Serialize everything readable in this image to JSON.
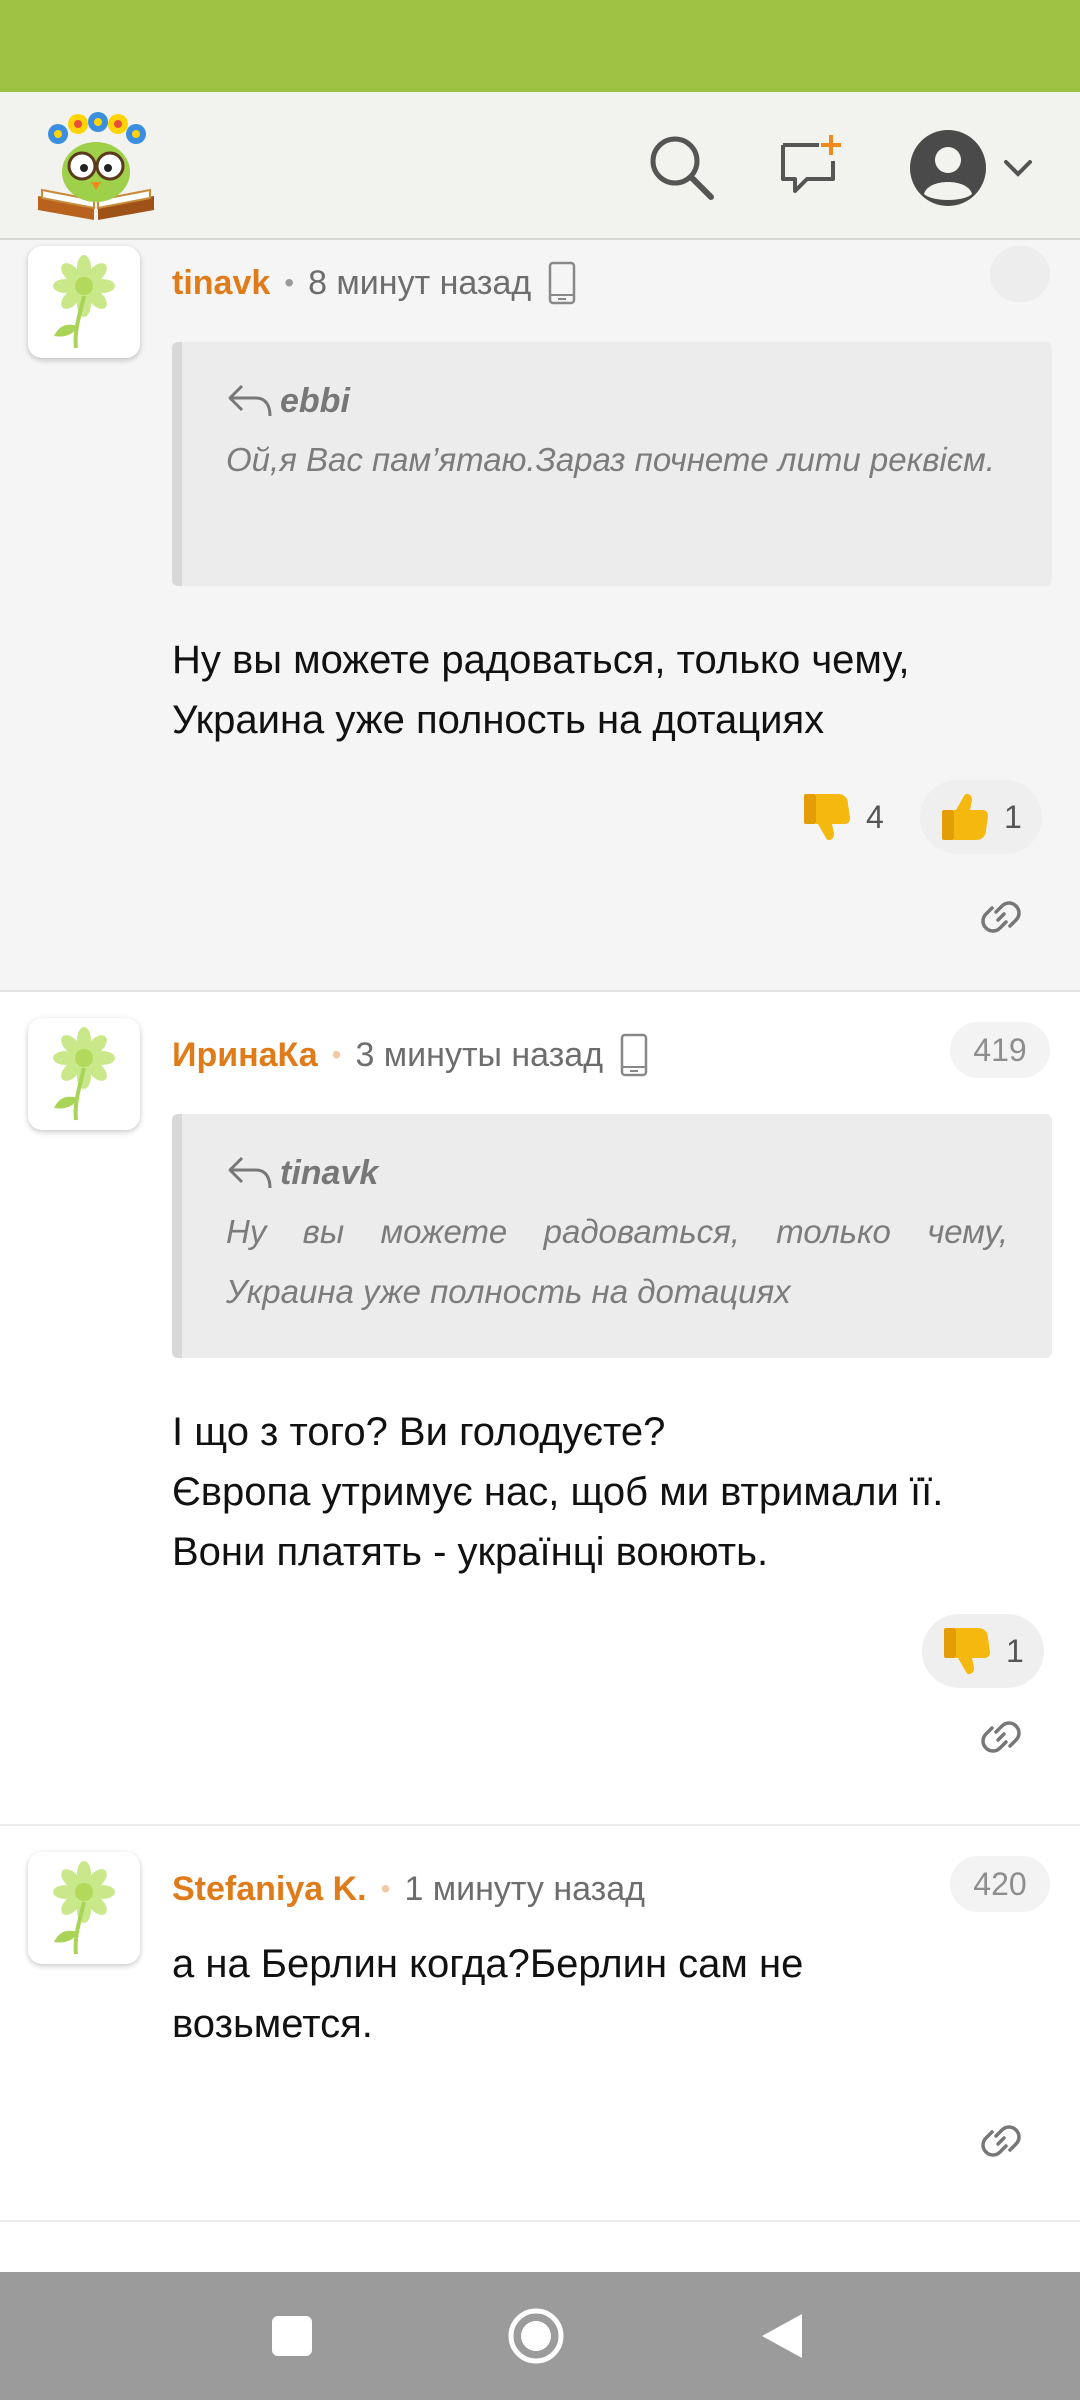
{
  "colors": {
    "status_bar": "#9dc242",
    "author": "#e07b1a",
    "nav_bar": "#9b9b9b",
    "thumb": "#f5b80e"
  },
  "header": {
    "logo": "library-owl-logo",
    "icons": [
      "search-icon",
      "add-comment-icon",
      "user-avatar-icon",
      "chevron-down-icon"
    ]
  },
  "comments": [
    {
      "author": "tinavk",
      "time": "8 минут назад",
      "device": "phone-icon",
      "quote": {
        "author": "ebbi",
        "text": "Ой,я Вас пам’ятаю.Зараз почнете лити реквієм."
      },
      "text": "Ну вы можете радоваться, только чему,\nУкраина уже полность на дотациях",
      "dislikes": "4",
      "likes": "1"
    },
    {
      "author": "ИринаКа",
      "time": "3 минуты назад",
      "device": "phone-icon",
      "number": "419",
      "quote": {
        "author": "tinavk",
        "text": "Ну вы можете радоваться, только чему, Украина уже полность на дотациях"
      },
      "text": "І що з того? Ви голодуєте?\nЄвропа утримує нас, щоб ми втримали її.\nВони платять - українці воюють.",
      "dislikes": "1"
    },
    {
      "author": "Stefaniya K.",
      "time": "1 минуту назад",
      "number": "420",
      "text": "а на Берлин когда?Берлин сам не\nвозьмется."
    }
  ],
  "nav": {
    "icons": [
      "recent-apps-icon",
      "home-icon",
      "back-icon"
    ]
  }
}
